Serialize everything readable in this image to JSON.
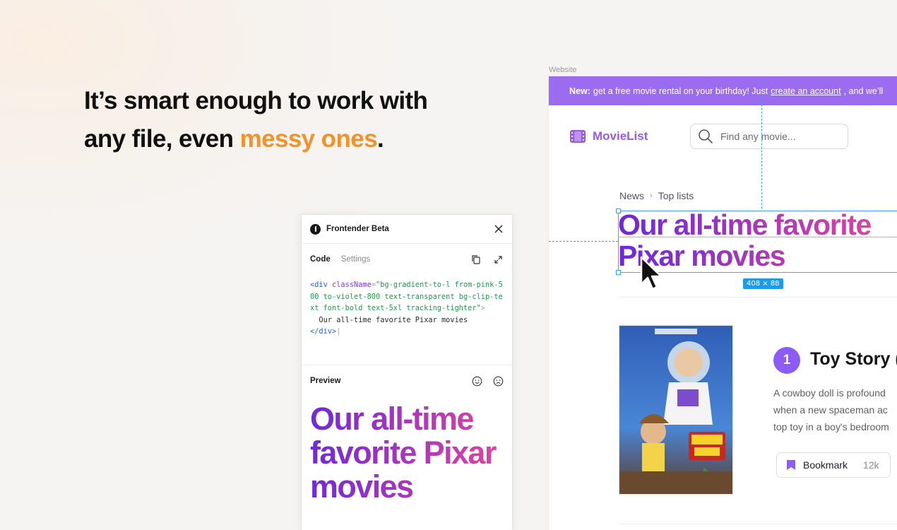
{
  "headline": {
    "line1": "It’s smart enough to work with",
    "line2_prefix": "any file, even ",
    "accent": "messy ones",
    "suffix": "."
  },
  "website": {
    "label": "Website",
    "banner": {
      "bold": "New:",
      "text": "get a free movie rental on your birthday! Just",
      "link": "create an account",
      "tail": ", and we’ll"
    },
    "logo_text": "MovieList",
    "search_placeholder": "Find any movie...",
    "breadcrumb": [
      "News",
      "Top lists"
    ],
    "title": "Our all-time favorite Pixar movies",
    "dimension": "408 × 88",
    "movie": {
      "rank": "1",
      "title": "Toy Story (",
      "desc": [
        "A cowboy doll is profound",
        "when a new spaceman ac",
        "top toy in a boy's bedroom"
      ],
      "bookmark_label": "Bookmark",
      "bookmark_count": "12k"
    }
  },
  "panel": {
    "title": "Frontender Beta",
    "tabs": [
      "Code",
      "Settings"
    ],
    "code": {
      "open_tag": "<div",
      "attr": "className",
      "value": "\"bg-gradient-to-l from-pink-500 to-violet-800 text-transparent bg-clip-text font-bold text-5xl tracking-tighter\"",
      "close_bracket": ">",
      "content": "Our all-time favorite Pixar movies",
      "close_tag": "</div>"
    },
    "preview_label": "Preview",
    "preview_text": "Our all-time favorite Pixar movies"
  },
  "colors": {
    "accent": "#f0932b",
    "banner": "#9b6cf0",
    "brand": "#9b59e6",
    "selection": "#3aa8e6"
  }
}
